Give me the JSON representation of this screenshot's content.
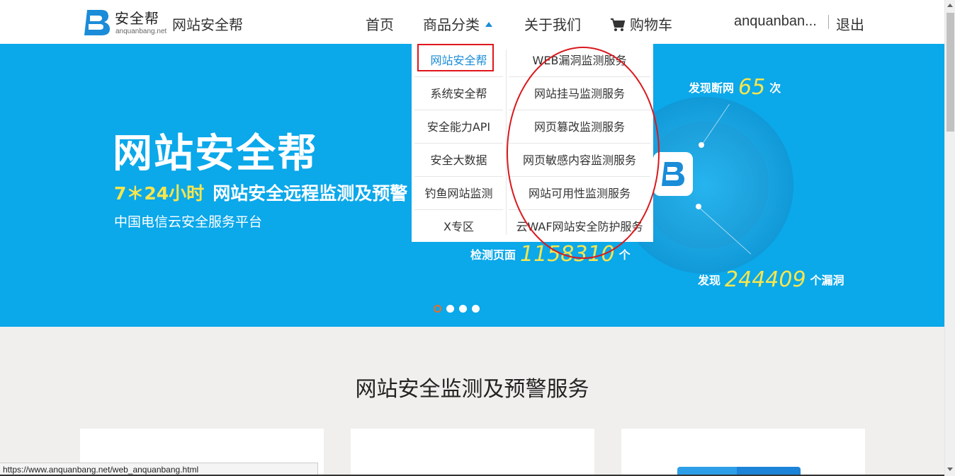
{
  "header": {
    "logo_text": "安全帮",
    "logo_sub": "anquanbang.net",
    "site_name": "网站安全帮",
    "nav": {
      "home": "首页",
      "categories": "商品分类",
      "about": "关于我们",
      "cart": "购物车"
    },
    "username": "anquanban...",
    "logout": "退出"
  },
  "banner": {
    "title": "网站安全帮",
    "subtitle_highlight": "7＊24小时",
    "subtitle": "网站安全远程监测及预警",
    "subtitle2": "中国电信云安全服务平台",
    "stats": {
      "outage_prefix": "发现断网",
      "outage_value": "65",
      "outage_suffix": "次",
      "pages_prefix": "检测页面",
      "pages_value": "1158310",
      "pages_suffix": "个",
      "vuln_prefix": "发现",
      "vuln_value": "244409",
      "vuln_suffix": "个漏洞"
    },
    "carousel_slides": 4,
    "carousel_active": 1
  },
  "dropdown": {
    "left": [
      "网站安全帮",
      "系统安全帮",
      "安全能力API",
      "安全大数据",
      "钓鱼网站监测",
      "X专区"
    ],
    "right": [
      "WEB漏洞监测服务",
      "网站挂马监测服务",
      "网页篡改监测服务",
      "网页敏感内容监测服务",
      "网站可用性监测服务",
      "云WAF网站安全防护服务"
    ],
    "active_left": "网站安全帮"
  },
  "section": {
    "title": "网站安全监测及预警服务"
  },
  "statusbar": {
    "url": "https://www.anquanbang.net/web_anquanbang.html"
  },
  "colors": {
    "banner_bg": "#0ba8ea",
    "highlight": "#f8e64d",
    "accent_blue": "#1a8cd8",
    "annotation_red": "#e0161c"
  }
}
